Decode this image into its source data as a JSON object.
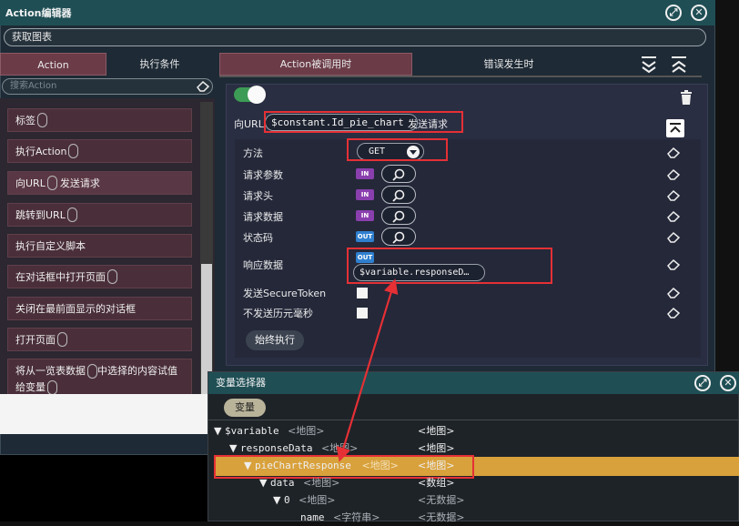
{
  "editor": {
    "title": "Action编辑器",
    "name": "获取图表",
    "left_tabs": [
      "Action",
      "执行条件"
    ],
    "search_placeholder": "搜索Action",
    "actions": [
      "标签",
      "执行Action",
      "向URL",
      "发送请求",
      "跳转到URL",
      "执行自定义脚本",
      "在对话框中打开页面",
      "关闭在最前面显示的对话框",
      "打开页面",
      "将从一览表数据",
      "中选择的内容试值",
      "给变量"
    ],
    "right_tabs": [
      "Action被调用时",
      "错误发生时"
    ]
  },
  "request": {
    "url_label": "向URL",
    "url_value": "$constant.Id_pie_chart",
    "url_suffix": "发送请求",
    "rows": {
      "method_label": "方法",
      "method_value": "GET",
      "params_label": "请求参数",
      "header_label": "请求头",
      "data_label": "请求数据",
      "status_label": "状态码",
      "response_label": "响应数据",
      "response_value": "$variable.responseD…",
      "secure_label": "发送SecureToken",
      "no_ms_label": "不发送历元毫秒"
    },
    "badges": {
      "in": "IN",
      "out": "OUT"
    },
    "run_label": "始终执行"
  },
  "var_selector": {
    "title": "变量选择器",
    "button": "变量",
    "rows": [
      {
        "name": "$variable",
        "type": "<地图>",
        "value": "<地图>"
      },
      {
        "name": "responseData",
        "type": "<地图>",
        "value": "<地图>"
      },
      {
        "name": "pieChartResponse",
        "type": "<地图>",
        "value": "<地图>"
      },
      {
        "name": "data",
        "type": "<地图>",
        "value": "<数组>"
      },
      {
        "name": "0",
        "type": "<地图>",
        "value": "<无数据>"
      },
      {
        "name": "name",
        "type": "<字符串>",
        "value": "<无数据>"
      }
    ]
  },
  "colors": {
    "accent": "#1f4f55",
    "highlight": "#d9a13b",
    "annotation": "#e53035"
  }
}
